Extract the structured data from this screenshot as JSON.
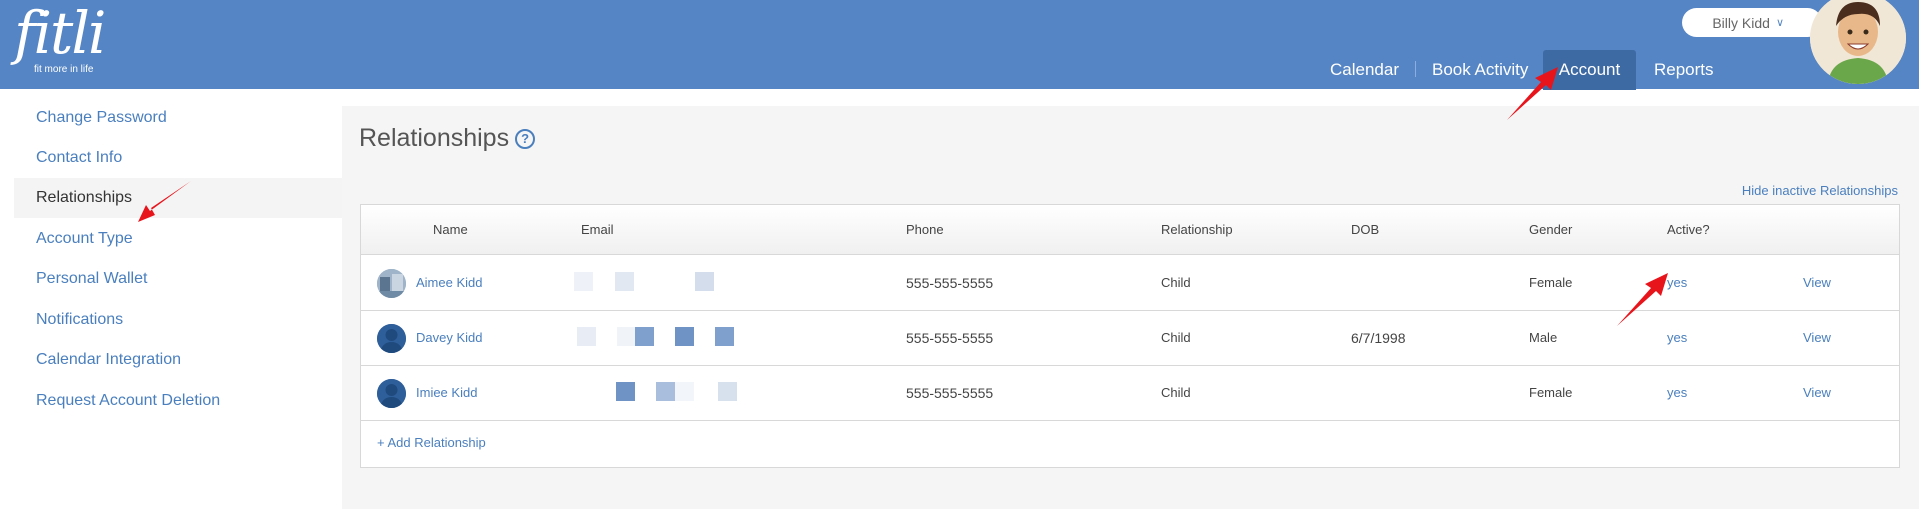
{
  "header": {
    "logo": {
      "word": "fitli",
      "tagline": "fit more in life"
    },
    "user": {
      "name": "Billy Kidd",
      "menu_icon": "chevron-down-icon"
    },
    "nav": [
      {
        "label": "Calendar"
      },
      {
        "label": "Book Activity"
      },
      {
        "label": "Account",
        "active": true
      },
      {
        "label": "Reports"
      }
    ]
  },
  "sidebar": {
    "items": [
      {
        "label": "Change Password"
      },
      {
        "label": "Contact Info"
      },
      {
        "label": "Relationships",
        "active": true
      },
      {
        "label": "Account Type"
      },
      {
        "label": "Personal Wallet"
      },
      {
        "label": "Notifications"
      },
      {
        "label": "Calendar Integration"
      },
      {
        "label": "Request Account Deletion"
      }
    ]
  },
  "main": {
    "title": "Relationships",
    "help_icon": "question-circle-icon",
    "hide_inactive_label": "Hide inactive Relationships",
    "table": {
      "columns": [
        "Name",
        "Email",
        "Phone",
        "Relationship",
        "DOB",
        "Gender",
        "Active?"
      ],
      "rows": [
        {
          "name": "Aimee Kidd",
          "phone": "555-555-5555",
          "relationship": "Child",
          "dob": "",
          "gender": "Female",
          "active": "yes",
          "action": "View"
        },
        {
          "name": "Davey Kidd",
          "phone": "555-555-5555",
          "relationship": "Child",
          "dob": "6/7/1998",
          "gender": "Male",
          "active": "yes",
          "action": "View"
        },
        {
          "name": "Imiee Kidd",
          "phone": "555-555-5555",
          "relationship": "Child",
          "dob": "",
          "gender": "Female",
          "active": "yes",
          "action": "View"
        }
      ]
    },
    "add_relationship_label": "+ Add Relationship"
  },
  "colors": {
    "header_bg": "#5585c4",
    "nav_active_bg": "#3e6aa4",
    "link": "#4a7fbe",
    "annotation_arrow": "#e8141c"
  }
}
